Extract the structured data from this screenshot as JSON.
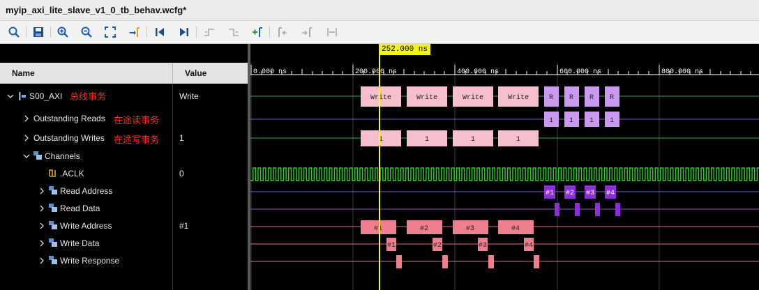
{
  "window": {
    "title": "myip_axi_lite_slave_v1_0_tb_behav.wcfg*"
  },
  "toolbar": {
    "buttons": [
      "search-icon",
      "save-icon",
      "zoom-in-icon",
      "zoom-out-icon",
      "zoom-fit-icon",
      "go-to-cursor-icon",
      "go-to-time-zero-icon",
      "go-to-last-time-icon",
      "previous-transition-icon",
      "next-transition-icon",
      "add-marker-icon",
      "previous-marker-icon",
      "next-marker-icon",
      "swap-cursors-icon"
    ]
  },
  "columns": {
    "name": "Name",
    "value": "Value"
  },
  "cursor": {
    "time_label": "252.000 ns"
  },
  "timeline": {
    "labels": [
      "0.000 ns",
      "200.000 ns",
      "400.000 ns",
      "600.000 ns",
      "800.000 ns"
    ]
  },
  "colors": {
    "cursor": "#f7f316",
    "transaction_pink": "#f6bfcc",
    "read_purple": "#c99af0",
    "channel_red": "#ef7f8e",
    "clock_green": "#27d327"
  },
  "rows": [
    {
      "name": "S00_AXI",
      "value": "Write",
      "annotation": "总线事务"
    },
    {
      "name": "Outstanding Reads",
      "value": "",
      "annotation": "在途读事务"
    },
    {
      "name": "Outstanding Writes",
      "value": "1",
      "annotation": "在途写事务"
    },
    {
      "name": "Channels",
      "value": ""
    },
    {
      "name": ".ACLK",
      "value": "0"
    },
    {
      "name": "Read Address",
      "value": ""
    },
    {
      "name": "Read Data",
      "value": ""
    },
    {
      "name": "Write Address",
      "value": "#1"
    },
    {
      "name": "Write Data",
      "value": ""
    },
    {
      "name": "Write Response",
      "value": ""
    }
  ],
  "waveform": {
    "s00_axi": {
      "write_label": "Write",
      "read_label": "R"
    },
    "outstanding_reads_label": "1",
    "outstanding_writes_label": "1",
    "read_address_labels": [
      "#1",
      "#2",
      "#3",
      "#4"
    ],
    "write_address_labels": [
      "#1",
      "#2",
      "#3",
      "#4"
    ],
    "write_data_labels": [
      "#1",
      "#2",
      "#3",
      "#4"
    ]
  }
}
